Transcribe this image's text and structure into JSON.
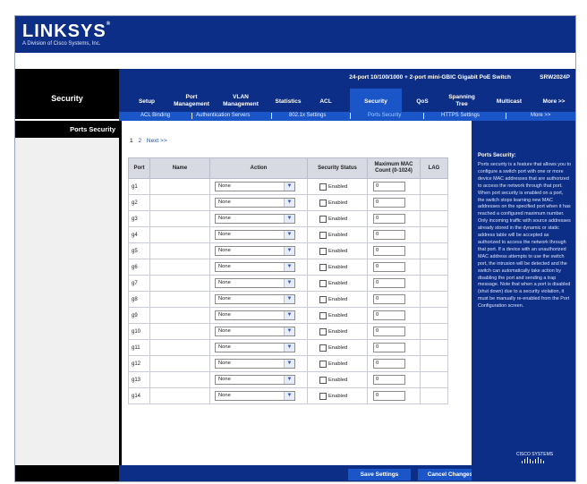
{
  "brand": {
    "logo": "LINKSYS",
    "reg": "®",
    "tagline": "A Division of Cisco Systems, Inc."
  },
  "device": {
    "product_name": "24-port 10/100/1000 + 2-port mini-GBIC Gigabit PoE Switch",
    "model": "SRW2024P"
  },
  "section_title": "Security",
  "tabs": [
    {
      "label": "Setup"
    },
    {
      "label": "Port\nManagement"
    },
    {
      "label": "VLAN\nManagement"
    },
    {
      "label": "Statistics"
    },
    {
      "label": "ACL"
    },
    {
      "label": "Security",
      "active": true
    },
    {
      "label": "QoS"
    },
    {
      "label": "Spanning\nTree"
    },
    {
      "label": "Multicast"
    },
    {
      "label": "More >>"
    }
  ],
  "subtabs": [
    {
      "label": "ACL Binding"
    },
    {
      "label": "Authentication Servers"
    },
    {
      "label": "802.1x Settings"
    },
    {
      "label": "Ports Security",
      "current": true
    },
    {
      "label": "HTTPS Settings"
    },
    {
      "label": "More >>"
    }
  ],
  "nav": {
    "current_page": "Ports Security"
  },
  "pager": {
    "page1": "1",
    "page2": "2",
    "next": "Next >>"
  },
  "table": {
    "headers": {
      "port": "Port",
      "name": "Name",
      "action": "Action",
      "status": "Security Status",
      "mac": "Maximum MAC\nCount (0-1024)",
      "lag": "LAG"
    },
    "rows": [
      {
        "port": "g1",
        "action": "None",
        "status_label": "Enabled",
        "mac": "0"
      },
      {
        "port": "g2",
        "action": "None",
        "status_label": "Enabled",
        "mac": "0"
      },
      {
        "port": "g3",
        "action": "None",
        "status_label": "Enabled",
        "mac": "0"
      },
      {
        "port": "g4",
        "action": "None",
        "status_label": "Enabled",
        "mac": "0"
      },
      {
        "port": "g5",
        "action": "None",
        "status_label": "Enabled",
        "mac": "0"
      },
      {
        "port": "g6",
        "action": "None",
        "status_label": "Enabled",
        "mac": "0"
      },
      {
        "port": "g7",
        "action": "None",
        "status_label": "Enabled",
        "mac": "0"
      },
      {
        "port": "g8",
        "action": "None",
        "status_label": "Enabled",
        "mac": "0"
      },
      {
        "port": "g9",
        "action": "None",
        "status_label": "Enabled",
        "mac": "0"
      },
      {
        "port": "g10",
        "action": "None",
        "status_label": "Enabled",
        "mac": "0"
      },
      {
        "port": "g11",
        "action": "None",
        "status_label": "Enabled",
        "mac": "0"
      },
      {
        "port": "g12",
        "action": "None",
        "status_label": "Enabled",
        "mac": "0"
      },
      {
        "port": "g13",
        "action": "None",
        "status_label": "Enabled",
        "mac": "0"
      },
      {
        "port": "g14",
        "action": "None",
        "status_label": "Enabled",
        "mac": "0"
      }
    ]
  },
  "help": {
    "title": "Ports Security:",
    "text": "Ports security is a feature that allows you to configure a switch port with one or more device MAC addresses that are authorized to access the network through that port. When port security is enabled on a port, the switch stops learning new MAC addresses on the specified port when it has reached a configured maximum number. Only incoming traffic with source addresses already stored in the dynamic or static address table will be accepted as authorized to access the network through that port. If a device with an unauthorized MAC address attempts to use the switch port, the intrusion will be detected and the switch can automatically take action by disabling the port and sending a trap message. Note that when a port is disabled (shut down) due to a security violation, it must be manually re-enabled from the Port Configuration screen."
  },
  "footer": {
    "save": "Save Settings",
    "cancel": "Cancel Changes",
    "cisco": "CISCO SYSTEMS"
  },
  "colors": {
    "brand_blue": "#0c2e86",
    "accent_blue": "#1a56c8",
    "black": "#000000"
  },
  "icons": {
    "select_arrow": "chevron-down-icon",
    "checkbox": "checkbox-icon"
  }
}
